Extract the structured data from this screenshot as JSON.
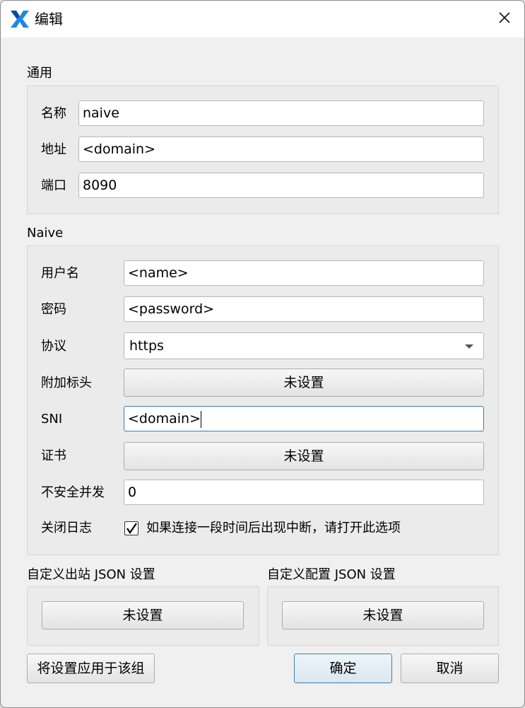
{
  "window": {
    "title": "编辑",
    "icon": "v2rayn-logo-icon",
    "accent_color": "#0078d4"
  },
  "general": {
    "section_title": "通用",
    "name_label": "名称",
    "name_value": "naive",
    "address_label": "地址",
    "address_value": "<domain>",
    "port_label": "端口",
    "port_value": "8090"
  },
  "naive": {
    "section_title": "Naive",
    "username_label": "用户名",
    "username_value": "<name>",
    "password_label": "密码",
    "password_value": "<password>",
    "protocol_label": "协议",
    "protocol_value": "https",
    "extra_headers_label": "附加标头",
    "extra_headers_button": "未设置",
    "sni_label": "SNI",
    "sni_value": "<domain>",
    "cert_label": "证书",
    "cert_button": "未设置",
    "insecure_label": "不安全并发",
    "insecure_value": "0",
    "disable_log_label": "关闭日志",
    "disable_log_checked": true,
    "disable_log_hint": "如果连接一段时间后出现中断，请打开此选项"
  },
  "custom_outbound": {
    "title": "自定义出站 JSON 设置",
    "button": "未设置"
  },
  "custom_config": {
    "title": "自定义配置 JSON 设置",
    "button": "未设置"
  },
  "footer": {
    "apply_group_button": "将设置应用于该组",
    "ok_button": "确定",
    "cancel_button": "取消"
  }
}
